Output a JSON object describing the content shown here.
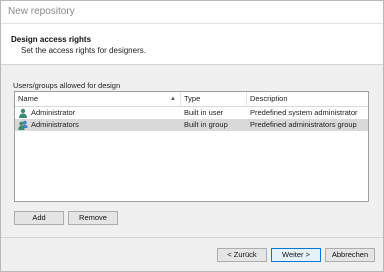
{
  "window": {
    "title": "New repository"
  },
  "header": {
    "title": "Design access rights",
    "subtitle": "Set the access rights for designers."
  },
  "group_label": "Users/groups allowed for design",
  "table": {
    "columns": [
      "Name",
      "Type",
      "Description"
    ],
    "rows": [
      {
        "icon": "user-icon",
        "name": "Administrator",
        "type": "Built in user",
        "description": "Predefined system administrator",
        "selected": false
      },
      {
        "icon": "group-icon",
        "name": "Administrators",
        "type": "Built in group",
        "description": "Predefined administrators group",
        "selected": true
      }
    ]
  },
  "buttons": {
    "add": "Add",
    "remove": "Remove",
    "back": "< Zurück",
    "next": "Weiter >",
    "cancel": "Abbrechen"
  },
  "colors": {
    "selection": "#d9d9d9",
    "user_icon": "#3c8c6e",
    "group_icon_secondary": "#4a7fbd",
    "default_button_border": "#0078d7"
  }
}
